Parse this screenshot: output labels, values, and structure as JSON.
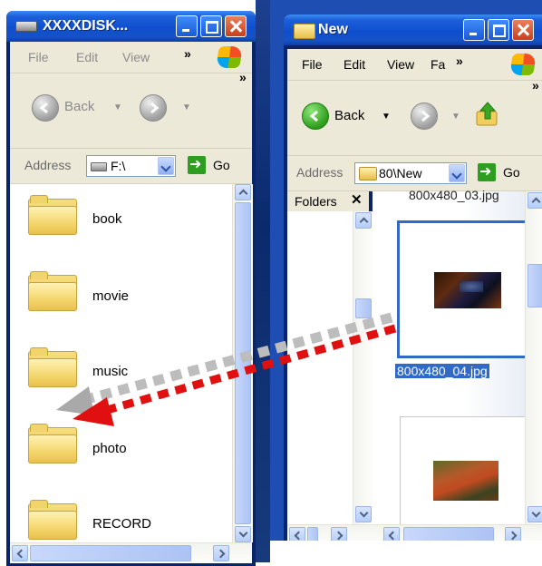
{
  "left_window": {
    "title": "XXXXDISK...",
    "menu": [
      "File",
      "Edit",
      "View"
    ],
    "toolbar": {
      "back_label": "Back"
    },
    "address": {
      "label": "Address",
      "value": "F:\\",
      "go_label": "Go"
    },
    "folders": [
      {
        "name": "book"
      },
      {
        "name": "movie"
      },
      {
        "name": "music"
      },
      {
        "name": "photo"
      },
      {
        "name": "RECORD"
      }
    ]
  },
  "right_window": {
    "title": "New",
    "menu": [
      "File",
      "Edit",
      "View",
      "Fa"
    ],
    "toolbar": {
      "back_label": "Back"
    },
    "address": {
      "label": "Address",
      "value": "80\\New",
      "go_label": "Go"
    },
    "folders_pane": {
      "label": "Folders"
    },
    "files": [
      {
        "name": "800x480_03.jpg"
      },
      {
        "name": "800x480_04.jpg",
        "selected": true
      }
    ]
  },
  "colors": {
    "titlebar": "#0f4fcf",
    "drag_arrow": "#e11010",
    "drag_ghost": "#bbbbbb",
    "selection": "#316ac5"
  },
  "icons": [
    "drive-icon",
    "folder-icon",
    "back-icon",
    "forward-icon",
    "up-folder-icon",
    "windows-logo-icon",
    "go-icon",
    "minimize-icon",
    "maximize-icon",
    "close-icon"
  ]
}
